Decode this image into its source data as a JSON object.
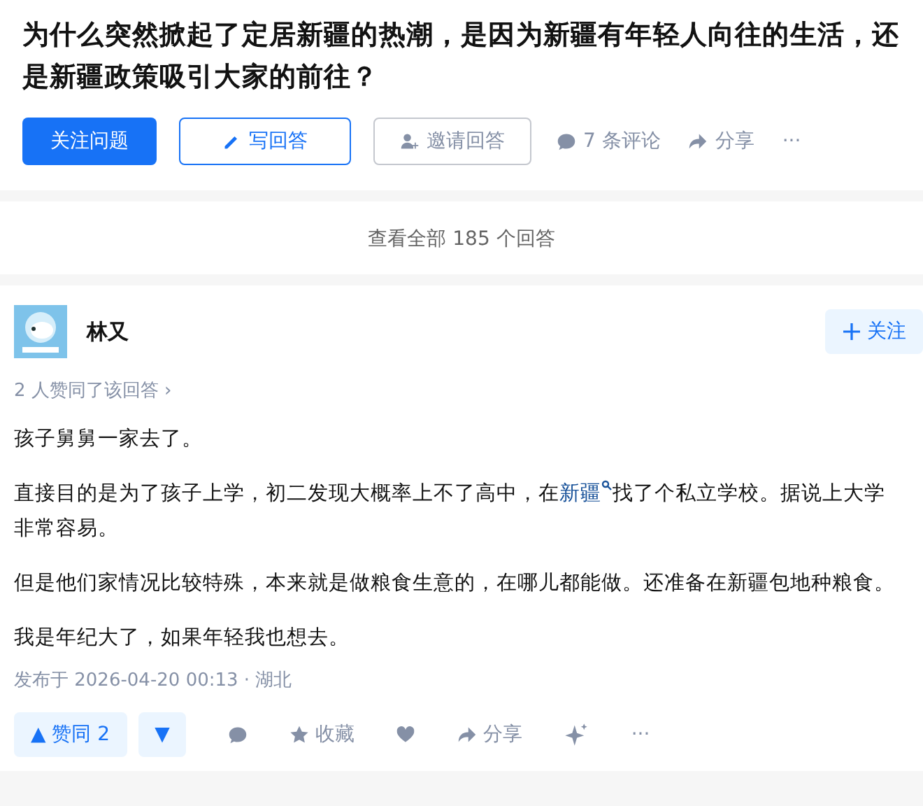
{
  "question": {
    "title": "为什么突然掀起了定居新疆的热潮，是因为新疆有年轻人向往的生活，还是新疆政策吸引大家的前往？"
  },
  "actions": [
    {
      "kind": "primary",
      "label": "关注问题"
    },
    {
      "kind": "write",
      "label": "写回答"
    },
    {
      "kind": "invite",
      "label": "邀请回答"
    },
    {
      "kind": "comment",
      "label": "7 条评论"
    },
    {
      "kind": "share",
      "label": "分享"
    },
    {
      "kind": "more",
      "label": "···"
    }
  ],
  "view_all": "查看全部 185 个回答",
  "answer": {
    "author": "林又",
    "follow": "关注",
    "upvoters": "2 人赞同了该回答 ›",
    "paragraphs": [
      {
        "parts": [
          {
            "text": "孩子舅舅一家去了。"
          }
        ]
      },
      {
        "parts": [
          {
            "text": "直接目的是为了孩子上学，初二发现大概率上不了高中，在"
          },
          {
            "text": "新疆",
            "kind": "link"
          },
          {
            "text": "找了个私立学校。据说上大学非常容易。"
          }
        ]
      },
      {
        "parts": [
          {
            "text": "但是他们家情况比较特殊，本来就是做粮食生意的，在哪儿都能做。还准备在新疆包地种粮食。"
          }
        ]
      },
      {
        "parts": [
          {
            "text": "我是年纪大了，如果年轻我也想去。"
          }
        ]
      }
    ],
    "published": "发布于 2026-04-20 00:13 · 湖北",
    "vote": {
      "up": "▲ 赞同 2",
      "down": "▼"
    },
    "bar": [
      {
        "kind": "comment"
      },
      {
        "kind": "star",
        "label": "收藏"
      },
      {
        "kind": "heart"
      },
      {
        "kind": "share",
        "label": "分享"
      },
      {
        "kind": "sparkle"
      },
      {
        "kind": "more",
        "label": "···"
      }
    ]
  }
}
